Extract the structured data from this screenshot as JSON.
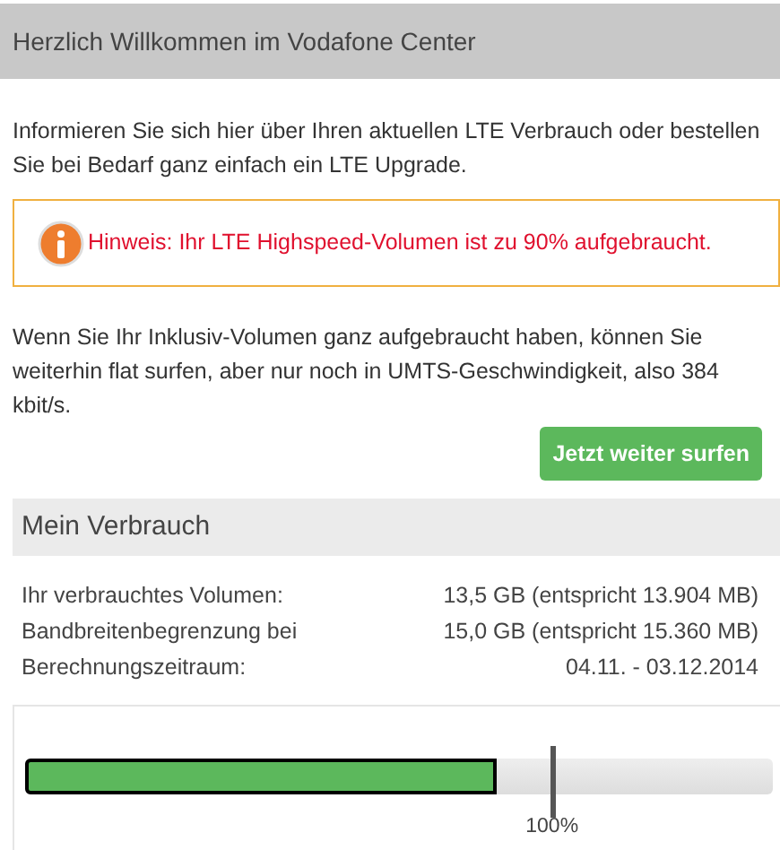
{
  "header": {
    "title": "Herzlich Willkommen im Vodafone Center"
  },
  "intro": "Informieren Sie sich hier über Ihren aktuellen LTE Verbrauch oder bestellen Sie bei Bedarf ganz einfach ein LTE Upgrade.",
  "notice": {
    "text": "Hinweis: Ihr LTE Highspeed-Volumen ist zu 90% aufgebraucht."
  },
  "info": "Wenn Sie Ihr Inklusiv-Volumen ganz aufgebraucht haben, können Sie weiterhin flat surfen, aber nur noch in UMTS-Geschwindigkeit, also 384 kbit/s.",
  "button": "Jetzt weiter surfen",
  "usage": {
    "title": "Mein Verbrauch",
    "rows": [
      {
        "label": "Ihr verbrauchtes Volumen:",
        "value": "13,5 GB (entspricht 13.904 MB)"
      },
      {
        "label": "Bandbreitenbegrenzung bei",
        "value": "15,0 GB (entspricht 15.360 MB)"
      },
      {
        "label": "Berechnungszeitraum:",
        "value": "04.11. - 03.12.2014"
      }
    ],
    "meter": {
      "level": 0.63
    },
    "limit_marker": {
      "label": "100%",
      "level": 0.703
    }
  }
}
